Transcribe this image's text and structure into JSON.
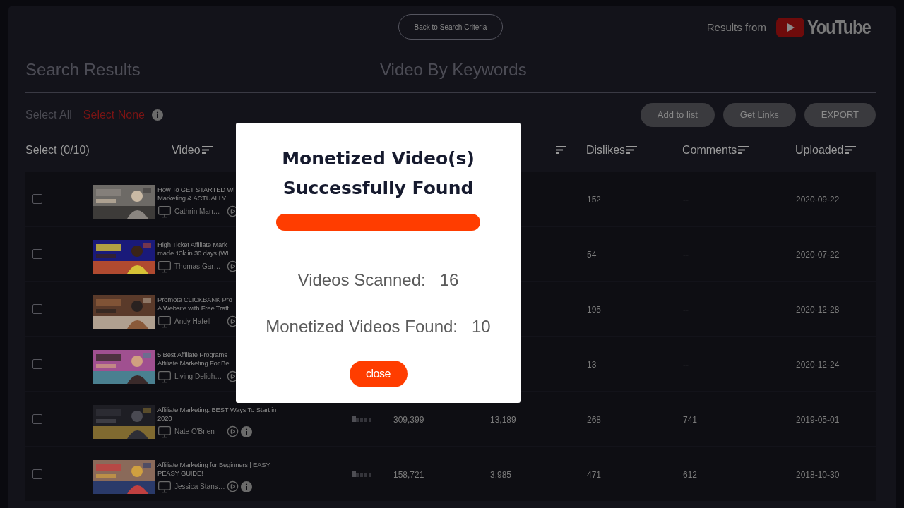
{
  "top_bar": {
    "back_button": "Back to Search Criteria",
    "results_from": "Results from",
    "logo_text": "YouTube"
  },
  "headings": {
    "left": "Search Results",
    "center": "Video By Keywords"
  },
  "selection": {
    "select_all": "Select All",
    "select_none": "Select None"
  },
  "actions": [
    "Add to list",
    "Get Links",
    "EXPORT"
  ],
  "table": {
    "columns": [
      "Select (0/10)",
      "Video",
      "Dislikes",
      "Comments",
      "Uploaded"
    ],
    "rows": [
      {
        "checked": false,
        "title_lines": [
          "How To GET STARTED Wi",
          "Marketing & ACTUALLY"
        ],
        "channel": "Cathrin Man…",
        "dislikes": "152",
        "comments": "--",
        "uploaded": "2020-09-22"
      },
      {
        "checked": false,
        "title_lines": [
          "High Ticket Affiliate Mark",
          "made 13k in 30 days (WI"
        ],
        "channel": "Thomas Gar…",
        "dislikes": "54",
        "comments": "--",
        "uploaded": "2020-07-22"
      },
      {
        "checked": false,
        "title_lines": [
          "Promote CLICKBANK Pro",
          "A Website with Free Traff"
        ],
        "channel": "Andy Hafell",
        "dislikes": "195",
        "comments": "--",
        "uploaded": "2020-12-28"
      },
      {
        "checked": false,
        "title_lines": [
          "5 Best Affiliate Programs",
          "Affiliate Marketing For Be"
        ],
        "channel": "Living Deligh…",
        "dislikes": "13",
        "comments": "--",
        "uploaded": "2020-12-24"
      },
      {
        "checked": false,
        "title_lines": [
          "Affiliate Marketing: BEST Ways To Start in",
          "2020"
        ],
        "channel": "Nate O'Brien",
        "info": true,
        "level": 0.2,
        "views": "309,399",
        "likes": "13,189",
        "dislikes": "268",
        "comments": "741",
        "uploaded": "2019-05-01"
      },
      {
        "checked": false,
        "title_lines": [
          "Affiliate Marketing for Beginners | EASY",
          "PEASY GUIDE!"
        ],
        "channel": "Jessica Stans…",
        "info": true,
        "level": 0.2,
        "views": "158,721",
        "likes": "3,985",
        "dislikes": "471",
        "comments": "612",
        "uploaded": "2018-10-30"
      }
    ]
  },
  "modal": {
    "title_lines": [
      "Monetized Video(s)",
      "Successfully Found"
    ],
    "level": 1,
    "stats": [
      {
        "label": "Videos Scanned:",
        "value": "16"
      },
      {
        "label": "Monetized Videos Found:",
        "value": "10"
      }
    ],
    "button": "close"
  }
}
